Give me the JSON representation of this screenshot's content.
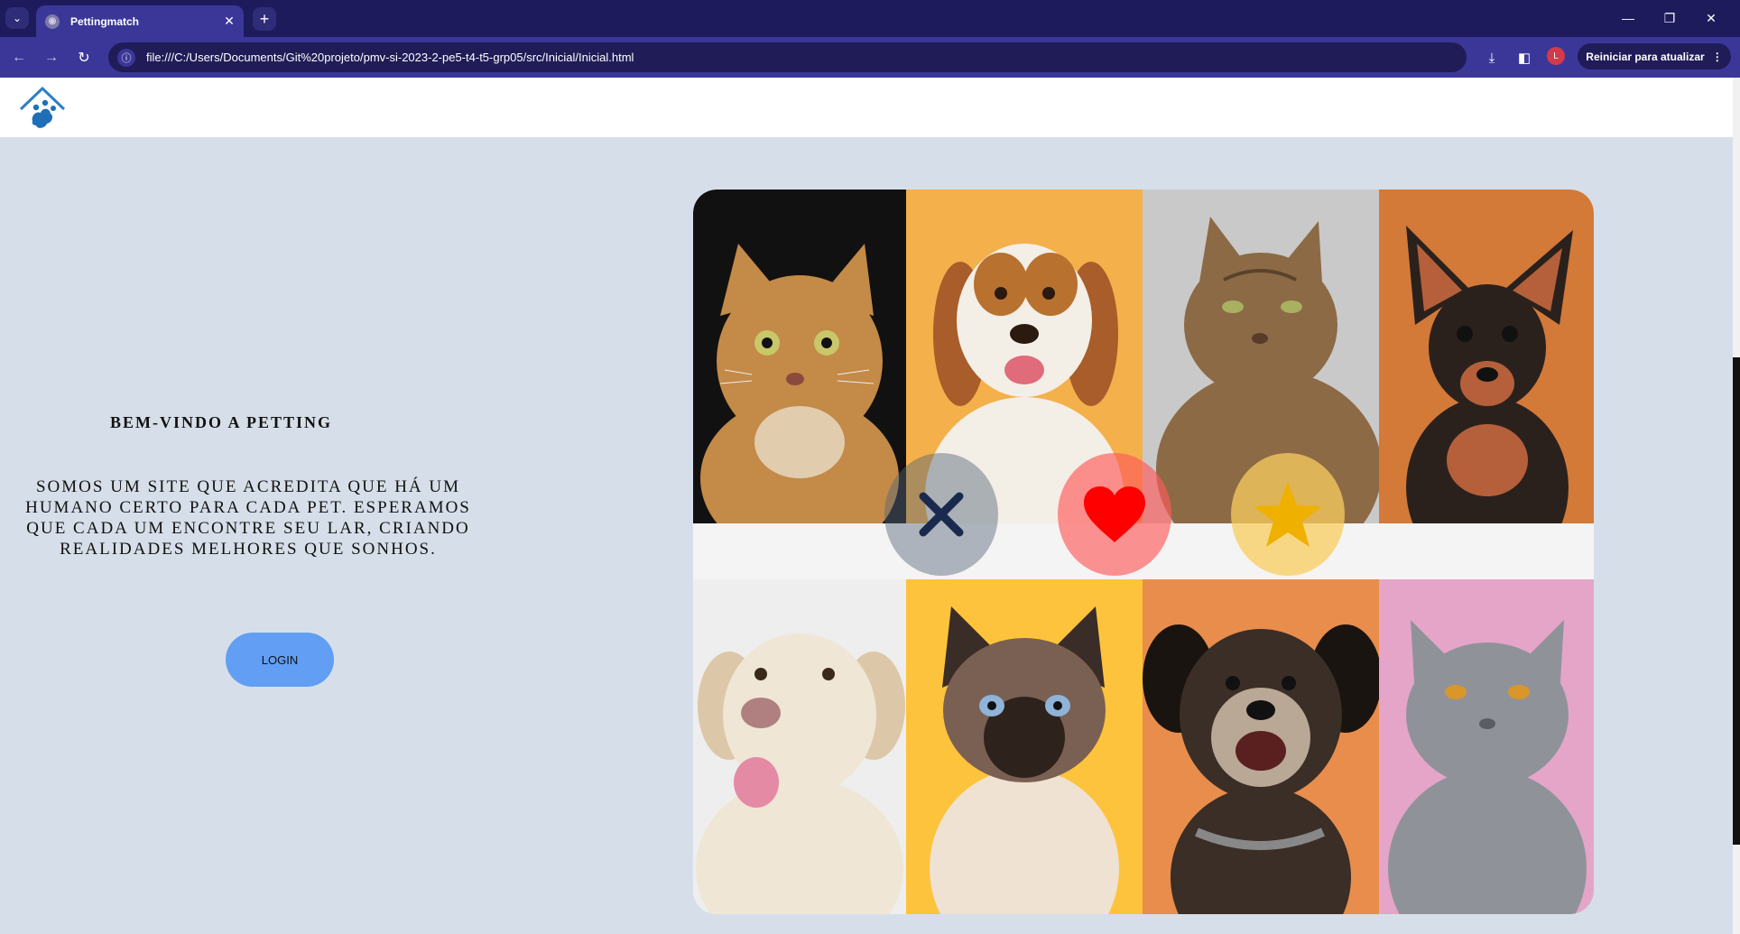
{
  "browser": {
    "tab_title": "Pettingmatch",
    "tab_close": "✕",
    "new_tab": "+",
    "url": "file:///C:/Users/Documents/Git%20projeto/pmv-si-2023-2-pe5-t4-t5-grp05/src/Inicial/Inicial.html",
    "profile_initial": "L",
    "update_button": "Reiniciar para atualizar"
  },
  "page": {
    "welcome_title": "BEM-VINDO A PETTING",
    "welcome_description": "SOMOS UM SITE QUE ACREDITA QUE HÁ UM HUMANO CERTO PARA CADA PET. ESPERAMOS QUE CADA UM ENCONTRE SEU LAR, CRIANDO REALIDADES MELHORES QUE SONHOS.",
    "login_button": "LOGIN"
  },
  "gallery": {
    "photos": [
      {
        "animal": "cat",
        "breed": "bengal",
        "background": "#111111",
        "fur": "#c48a48"
      },
      {
        "animal": "dog",
        "breed": "beagle-mix",
        "background": "#f4b04a",
        "fur": "#f3eee6"
      },
      {
        "animal": "cat",
        "breed": "tabby",
        "background": "#c9c9c9",
        "fur": "#8c6a46"
      },
      {
        "animal": "dog",
        "breed": "miniature-pinscher",
        "background": "#d37a38",
        "fur": "#2b211c"
      },
      {
        "animal": "dog",
        "breed": "labrador",
        "background": "#eeeeee",
        "fur": "#efe6d6"
      },
      {
        "animal": "cat",
        "breed": "siamese",
        "background": "#fdc33c",
        "fur": "#efe2d2"
      },
      {
        "animal": "dog",
        "breed": "mixed-terrier",
        "background": "#e88d4c",
        "fur": "#3a2e26"
      },
      {
        "animal": "cat",
        "breed": "british-shorthair",
        "background": "#e4a5c8",
        "fur": "#8f9399"
      }
    ],
    "actions": [
      {
        "name": "reject",
        "icon": "x-icon",
        "color": "#1a2a4f"
      },
      {
        "name": "like",
        "icon": "heart-icon",
        "color": "#ff0000"
      },
      {
        "name": "favorite",
        "icon": "star-icon",
        "color": "#f0b000"
      }
    ]
  },
  "colors": {
    "browser_tabbar": "#1e1b5c",
    "browser_toolbar": "#3b3799",
    "page_background": "#d6dfe9",
    "login_button": "#619ef4",
    "logo_blue": "#2f7fc4"
  }
}
